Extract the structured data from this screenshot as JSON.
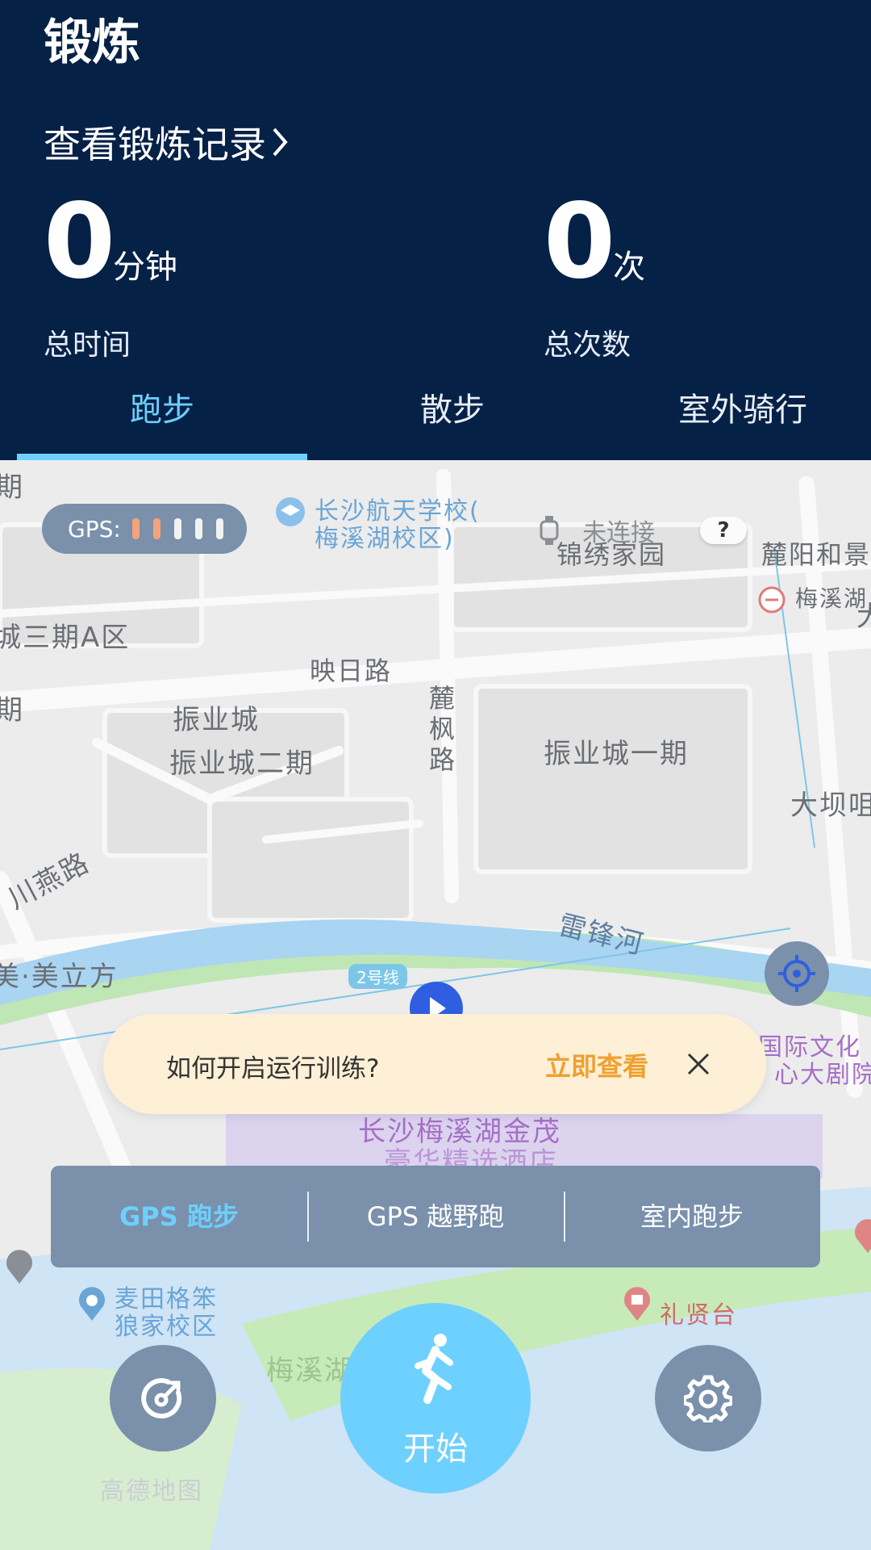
{
  "header": {
    "title": "锻炼",
    "records_link": "查看锻炼记录",
    "total_time": {
      "value": "0",
      "unit": "分钟",
      "label": "总时间"
    },
    "total_count": {
      "value": "0",
      "unit": "次",
      "label": "总次数"
    },
    "tabs": [
      "跑步",
      "散步",
      "室外骑行"
    ],
    "active_tab": "跑步"
  },
  "map": {
    "gps_label": "GPS:",
    "gps_signal_bars": 5,
    "gps_signal_level": 2,
    "device_status": "未连接",
    "help_label": "?",
    "labels": [
      "长沙航天学校(",
      "梅溪湖校区)",
      "锦绣家园",
      "麓阳和景",
      "梅溪湖",
      "城三期A区",
      "映日路",
      "麓",
      "枫",
      "路",
      "振业城",
      "振业城二期",
      "振业城一期",
      "大坝咀",
      "川燕路",
      "美·美立方",
      "雷锋河",
      "2号线",
      "国际文化",
      "心大剧院",
      "长沙梅溪湖金茂",
      "豪华精选酒店",
      "麦田格笨",
      "狼家校区",
      "礼贤台",
      "梅溪湖",
      "高德地图",
      "期",
      "期",
      "大"
    ]
  },
  "banner": {
    "text": "如何开启运行训练?",
    "link": "立即查看"
  },
  "modes": [
    "GPS 跑步",
    "GPS 越野跑",
    "室内跑步"
  ],
  "active_mode": "GPS 跑步",
  "controls": {
    "start_label": "开始"
  },
  "colors": {
    "header_bg": "#052146",
    "accent": "#6dd0ff",
    "panel": "#7a90ab",
    "banner_bg": "#fdf0d6",
    "banner_link": "#f0a030",
    "gps_on": "#f4a37a"
  }
}
